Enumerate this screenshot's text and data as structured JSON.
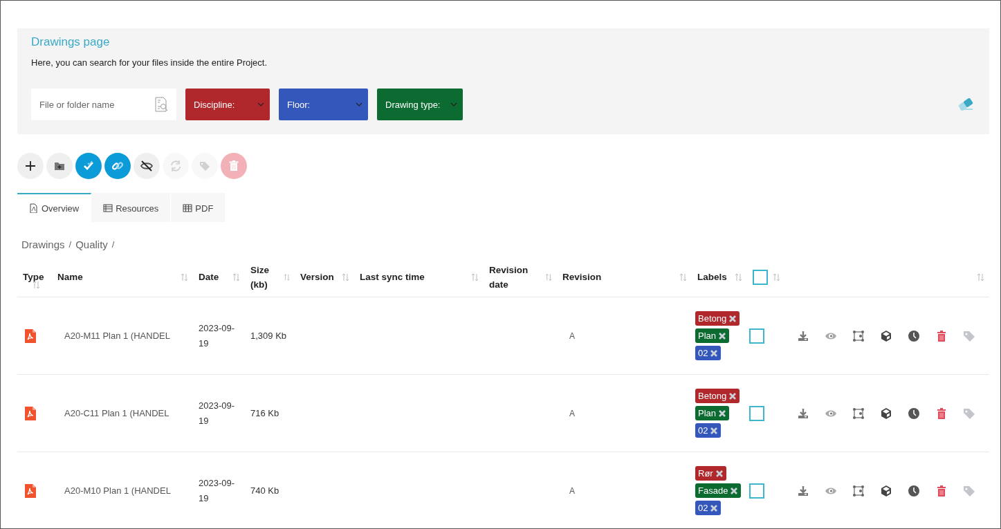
{
  "header": {
    "title": "Drawings page",
    "description": "Here, you can search for your files inside the entire Project.",
    "search": {
      "placeholder": "File or folder name"
    },
    "filters": [
      {
        "label": "Discipline:",
        "color": "#b0282c"
      },
      {
        "label": "Floor:",
        "color": "#3457bb"
      },
      {
        "label": "Drawing type:",
        "color": "#0b6b30"
      }
    ]
  },
  "toolbar": [
    {
      "kind": "add",
      "active": false,
      "disabled": false
    },
    {
      "kind": "folder",
      "active": false,
      "disabled": false
    },
    {
      "kind": "check",
      "active": true,
      "disabled": false
    },
    {
      "kind": "link",
      "active": true,
      "disabled": false
    },
    {
      "kind": "hide",
      "active": false,
      "disabled": false
    },
    {
      "kind": "sync",
      "active": false,
      "disabled": true
    },
    {
      "kind": "tag",
      "active": false,
      "disabled": true
    },
    {
      "kind": "delete",
      "active": false,
      "disabled": true
    }
  ],
  "tabs": [
    {
      "label": "Overview",
      "kind": "pdf",
      "selected": true
    },
    {
      "label": "Resources",
      "kind": "list",
      "selected": false
    },
    {
      "label": "PDF",
      "kind": "grid",
      "selected": false
    }
  ],
  "breadcrumb": {
    "separator": "/",
    "items": [
      "Drawings",
      "Quality"
    ]
  },
  "table": {
    "columns": [
      {
        "kind": "text",
        "label": "Type"
      },
      {
        "kind": "text",
        "label": "Name"
      },
      {
        "kind": "text",
        "label": "Date"
      },
      {
        "kind": "text",
        "label": "Size (kb)"
      },
      {
        "kind": "text",
        "label": "Version"
      },
      {
        "kind": "text",
        "label": "Last sync time"
      },
      {
        "kind": "text",
        "label": "Revision date"
      },
      {
        "kind": "text",
        "label": "Revision"
      },
      {
        "kind": "text",
        "label": "Labels"
      },
      {
        "kind": "checkbox",
        "checked": false
      },
      {
        "kind": "blank"
      }
    ],
    "rows": [
      {
        "name": "A20-M11 Plan 1 (HANDEL",
        "date": "2023-09-19",
        "size": "1,309 Kb",
        "revision": "A",
        "checked": false,
        "labels": [
          {
            "text": "Betong",
            "color": "#b0282c"
          },
          {
            "text": "Plan",
            "color": "#0b6b30"
          },
          {
            "text": "02",
            "color": "#3457bb"
          }
        ]
      },
      {
        "name": "A20-C11 Plan 1 (HANDEL",
        "date": "2023-09-19",
        "size": "716 Kb",
        "revision": "A",
        "checked": false,
        "labels": [
          {
            "text": "Betong",
            "color": "#b0282c"
          },
          {
            "text": "Plan",
            "color": "#0b6b30"
          },
          {
            "text": "02",
            "color": "#3457bb"
          }
        ]
      },
      {
        "name": "A20-M10 Plan 1 (HANDEL",
        "date": "2023-09-19",
        "size": "740 Kb",
        "revision": "A",
        "checked": false,
        "labels": [
          {
            "text": "Rør",
            "color": "#b0282c"
          },
          {
            "text": "Fasade",
            "color": "#0b6b30"
          },
          {
            "text": "02",
            "color": "#3457bb"
          }
        ]
      }
    ]
  }
}
